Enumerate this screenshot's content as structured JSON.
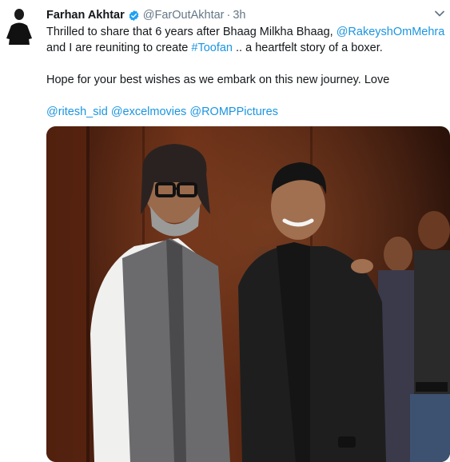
{
  "tweet": {
    "author_name": "Farhan Akhtar",
    "author_handle": "@FarOutAkhtar",
    "separator": "·",
    "timestamp": "3h",
    "text_part1": "Thrilled to share that 6 years after Bhaag Milkha Bhaag, ",
    "mention_rakeysh": "@RakeyshOmMehra",
    "text_part2": " and I are reuniting to create ",
    "hashtag": "#Toofan",
    "text_part3": " .. a heartfelt story of a boxer.",
    "paragraph2": "Hope for your best wishes as we embark on this new journey. Love",
    "mentions": [
      "@ritesh_sid",
      "@excelmovies",
      "@ROMPPictures"
    ]
  },
  "icons": {
    "verified": "verified-badge-icon",
    "more": "chevron-down-icon",
    "avatar": "profile-avatar"
  },
  "colors": {
    "link": "#1b95e0",
    "meta": "#657786",
    "text": "#14171a"
  }
}
